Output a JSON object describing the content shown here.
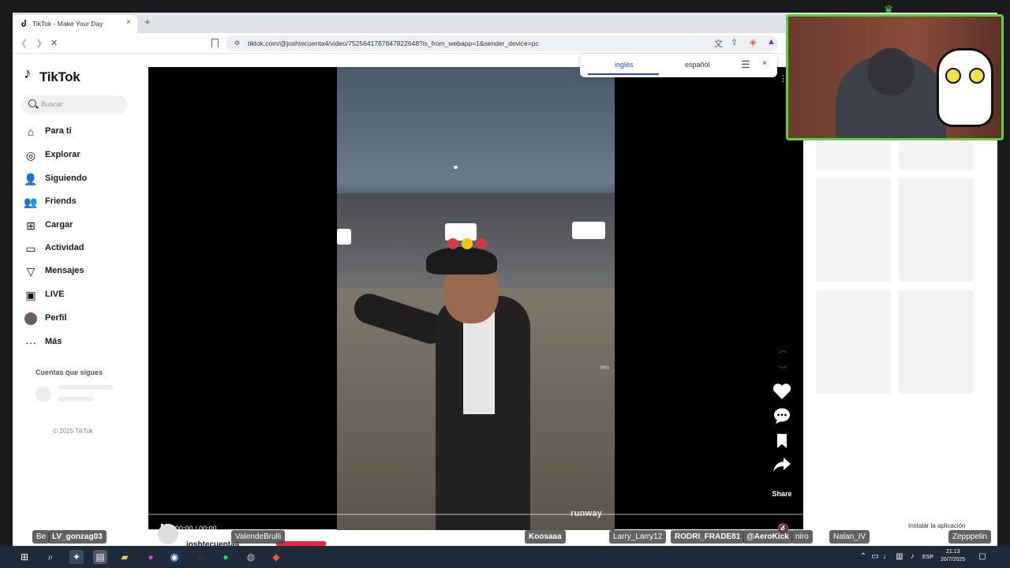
{
  "browser": {
    "tab_title": "TikTok - Make Your Day",
    "tab_close": "×",
    "new_tab": "+",
    "url": "tiktok.com/@joshtecuenta4/video/7525641787847822648?is_from_webapp=1&sender_device=pc",
    "window_controls": [
      "—",
      "□",
      "✕"
    ]
  },
  "translate_popup": {
    "source_lang": "inglés",
    "target_lang": "español",
    "close": "×"
  },
  "sidebar": {
    "logo": "TikTok",
    "search_placeholder": "Buscar",
    "items": [
      {
        "label": "Para ti",
        "icon": "home-icon"
      },
      {
        "label": "Explorar",
        "icon": "compass-icon"
      },
      {
        "label": "Siguiendo",
        "icon": "user-follow-icon"
      },
      {
        "label": "Friends",
        "icon": "friends-icon"
      },
      {
        "label": "Cargar",
        "icon": "upload-icon"
      },
      {
        "label": "Actividad",
        "icon": "activity-icon"
      },
      {
        "label": "Mensajes",
        "icon": "message-icon"
      },
      {
        "label": "LIVE",
        "icon": "live-icon"
      },
      {
        "label": "Perfil",
        "icon": "avatar"
      },
      {
        "label": "Más",
        "icon": "more-icon"
      }
    ],
    "following_title": "Cuentas que sigues",
    "copyright": "© 2025 TikTok"
  },
  "video": {
    "time": "00:00 / 00:00",
    "watermark_veo": "Veo",
    "watermark_runway": "runway",
    "share_label": "Share",
    "username": "joshtecuenta4",
    "progress": 0
  },
  "install_app": "Instalar la aplicación",
  "chat_names": {
    "n1": "Be",
    "n2": "LV_gonzag03",
    "n3": "ValendeBrulli",
    "n4": "Koosaaa",
    "n5": "Larry_Larry12",
    "n6": "RODRI_FRADE81",
    "n7": "@AeroKick",
    "n8": "niro",
    "n9": "Nalan_IV",
    "n10": "Zepppelin"
  },
  "taskbar": {
    "lang": "ESP",
    "time": "21:13",
    "date": "20/7/2025"
  },
  "colors": {
    "accent_blue": "#1a4fc4",
    "stream_green": "#5fd03f",
    "tiktok_red": "#e5284a"
  }
}
